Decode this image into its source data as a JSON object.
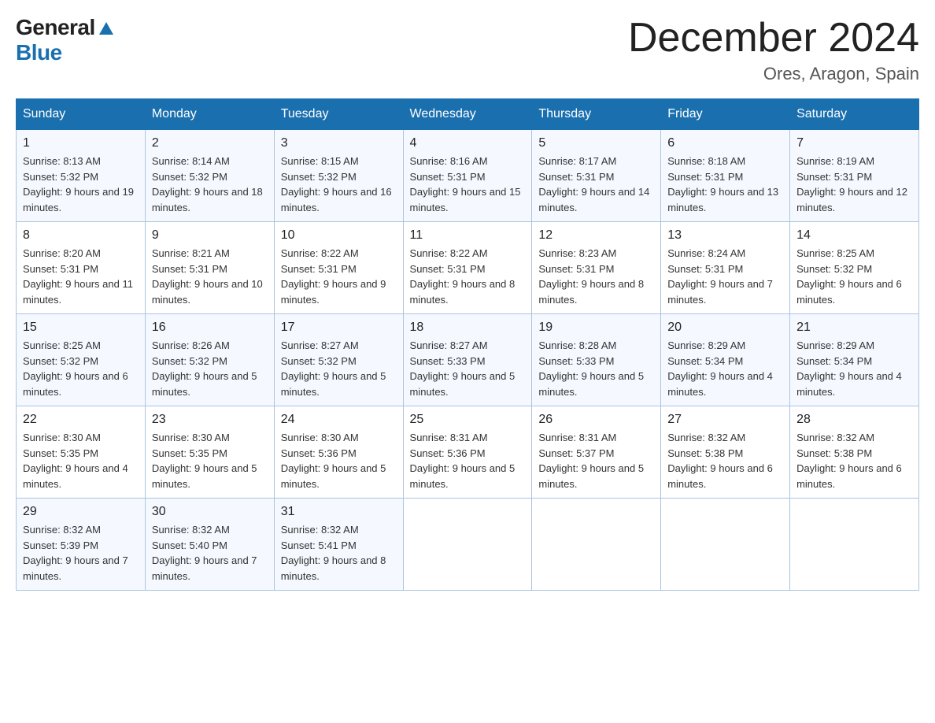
{
  "logo": {
    "general": "General",
    "blue": "Blue",
    "triangle": "▲"
  },
  "title": "December 2024",
  "subtitle": "Ores, Aragon, Spain",
  "days_of_week": [
    "Sunday",
    "Monday",
    "Tuesday",
    "Wednesday",
    "Thursday",
    "Friday",
    "Saturday"
  ],
  "weeks": [
    [
      {
        "day": "1",
        "sunrise": "Sunrise: 8:13 AM",
        "sunset": "Sunset: 5:32 PM",
        "daylight": "Daylight: 9 hours and 19 minutes."
      },
      {
        "day": "2",
        "sunrise": "Sunrise: 8:14 AM",
        "sunset": "Sunset: 5:32 PM",
        "daylight": "Daylight: 9 hours and 18 minutes."
      },
      {
        "day": "3",
        "sunrise": "Sunrise: 8:15 AM",
        "sunset": "Sunset: 5:32 PM",
        "daylight": "Daylight: 9 hours and 16 minutes."
      },
      {
        "day": "4",
        "sunrise": "Sunrise: 8:16 AM",
        "sunset": "Sunset: 5:31 PM",
        "daylight": "Daylight: 9 hours and 15 minutes."
      },
      {
        "day": "5",
        "sunrise": "Sunrise: 8:17 AM",
        "sunset": "Sunset: 5:31 PM",
        "daylight": "Daylight: 9 hours and 14 minutes."
      },
      {
        "day": "6",
        "sunrise": "Sunrise: 8:18 AM",
        "sunset": "Sunset: 5:31 PM",
        "daylight": "Daylight: 9 hours and 13 minutes."
      },
      {
        "day": "7",
        "sunrise": "Sunrise: 8:19 AM",
        "sunset": "Sunset: 5:31 PM",
        "daylight": "Daylight: 9 hours and 12 minutes."
      }
    ],
    [
      {
        "day": "8",
        "sunrise": "Sunrise: 8:20 AM",
        "sunset": "Sunset: 5:31 PM",
        "daylight": "Daylight: 9 hours and 11 minutes."
      },
      {
        "day": "9",
        "sunrise": "Sunrise: 8:21 AM",
        "sunset": "Sunset: 5:31 PM",
        "daylight": "Daylight: 9 hours and 10 minutes."
      },
      {
        "day": "10",
        "sunrise": "Sunrise: 8:22 AM",
        "sunset": "Sunset: 5:31 PM",
        "daylight": "Daylight: 9 hours and 9 minutes."
      },
      {
        "day": "11",
        "sunrise": "Sunrise: 8:22 AM",
        "sunset": "Sunset: 5:31 PM",
        "daylight": "Daylight: 9 hours and 8 minutes."
      },
      {
        "day": "12",
        "sunrise": "Sunrise: 8:23 AM",
        "sunset": "Sunset: 5:31 PM",
        "daylight": "Daylight: 9 hours and 8 minutes."
      },
      {
        "day": "13",
        "sunrise": "Sunrise: 8:24 AM",
        "sunset": "Sunset: 5:31 PM",
        "daylight": "Daylight: 9 hours and 7 minutes."
      },
      {
        "day": "14",
        "sunrise": "Sunrise: 8:25 AM",
        "sunset": "Sunset: 5:32 PM",
        "daylight": "Daylight: 9 hours and 6 minutes."
      }
    ],
    [
      {
        "day": "15",
        "sunrise": "Sunrise: 8:25 AM",
        "sunset": "Sunset: 5:32 PM",
        "daylight": "Daylight: 9 hours and 6 minutes."
      },
      {
        "day": "16",
        "sunrise": "Sunrise: 8:26 AM",
        "sunset": "Sunset: 5:32 PM",
        "daylight": "Daylight: 9 hours and 5 minutes."
      },
      {
        "day": "17",
        "sunrise": "Sunrise: 8:27 AM",
        "sunset": "Sunset: 5:32 PM",
        "daylight": "Daylight: 9 hours and 5 minutes."
      },
      {
        "day": "18",
        "sunrise": "Sunrise: 8:27 AM",
        "sunset": "Sunset: 5:33 PM",
        "daylight": "Daylight: 9 hours and 5 minutes."
      },
      {
        "day": "19",
        "sunrise": "Sunrise: 8:28 AM",
        "sunset": "Sunset: 5:33 PM",
        "daylight": "Daylight: 9 hours and 5 minutes."
      },
      {
        "day": "20",
        "sunrise": "Sunrise: 8:29 AM",
        "sunset": "Sunset: 5:34 PM",
        "daylight": "Daylight: 9 hours and 4 minutes."
      },
      {
        "day": "21",
        "sunrise": "Sunrise: 8:29 AM",
        "sunset": "Sunset: 5:34 PM",
        "daylight": "Daylight: 9 hours and 4 minutes."
      }
    ],
    [
      {
        "day": "22",
        "sunrise": "Sunrise: 8:30 AM",
        "sunset": "Sunset: 5:35 PM",
        "daylight": "Daylight: 9 hours and 4 minutes."
      },
      {
        "day": "23",
        "sunrise": "Sunrise: 8:30 AM",
        "sunset": "Sunset: 5:35 PM",
        "daylight": "Daylight: 9 hours and 5 minutes."
      },
      {
        "day": "24",
        "sunrise": "Sunrise: 8:30 AM",
        "sunset": "Sunset: 5:36 PM",
        "daylight": "Daylight: 9 hours and 5 minutes."
      },
      {
        "day": "25",
        "sunrise": "Sunrise: 8:31 AM",
        "sunset": "Sunset: 5:36 PM",
        "daylight": "Daylight: 9 hours and 5 minutes."
      },
      {
        "day": "26",
        "sunrise": "Sunrise: 8:31 AM",
        "sunset": "Sunset: 5:37 PM",
        "daylight": "Daylight: 9 hours and 5 minutes."
      },
      {
        "day": "27",
        "sunrise": "Sunrise: 8:32 AM",
        "sunset": "Sunset: 5:38 PM",
        "daylight": "Daylight: 9 hours and 6 minutes."
      },
      {
        "day": "28",
        "sunrise": "Sunrise: 8:32 AM",
        "sunset": "Sunset: 5:38 PM",
        "daylight": "Daylight: 9 hours and 6 minutes."
      }
    ],
    [
      {
        "day": "29",
        "sunrise": "Sunrise: 8:32 AM",
        "sunset": "Sunset: 5:39 PM",
        "daylight": "Daylight: 9 hours and 7 minutes."
      },
      {
        "day": "30",
        "sunrise": "Sunrise: 8:32 AM",
        "sunset": "Sunset: 5:40 PM",
        "daylight": "Daylight: 9 hours and 7 minutes."
      },
      {
        "day": "31",
        "sunrise": "Sunrise: 8:32 AM",
        "sunset": "Sunset: 5:41 PM",
        "daylight": "Daylight: 9 hours and 8 minutes."
      },
      null,
      null,
      null,
      null
    ]
  ]
}
